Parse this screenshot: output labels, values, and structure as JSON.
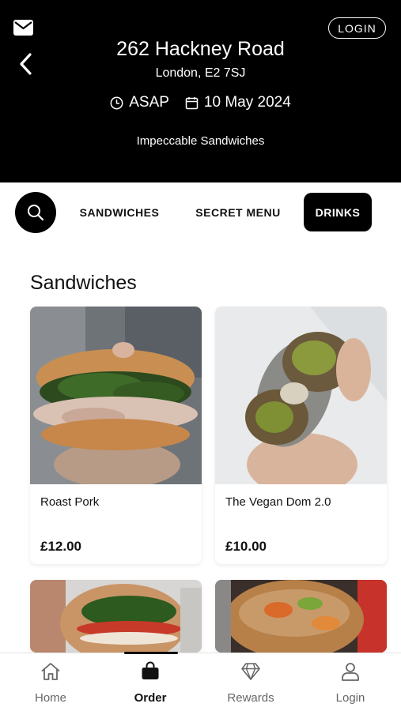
{
  "header": {
    "login_label": "LOGIN",
    "address_title": "262 Hackney Road",
    "address_sub": "London, E2 7SJ",
    "time_label": "ASAP",
    "date_label": "10 May 2024",
    "tagline": "Impeccable Sandwiches"
  },
  "categories": {
    "items": [
      {
        "label": "SANDWICHES",
        "active": false
      },
      {
        "label": "SECRET MENU",
        "active": false
      },
      {
        "label": "DRINKS",
        "active": true
      }
    ]
  },
  "section": {
    "title": "Sandwiches"
  },
  "products": [
    {
      "name": "Roast Pork",
      "price": "£12.00"
    },
    {
      "name": "The Vegan Dom 2.0",
      "price": "£10.00"
    },
    {
      "name": "",
      "price": ""
    },
    {
      "name": "",
      "price": ""
    }
  ],
  "tabbar": {
    "items": [
      {
        "label": "Home",
        "icon": "home-icon",
        "active": false
      },
      {
        "label": "Order",
        "icon": "bag-icon",
        "active": true
      },
      {
        "label": "Rewards",
        "icon": "diamond-icon",
        "active": false
      },
      {
        "label": "Login",
        "icon": "user-icon",
        "active": false
      }
    ]
  },
  "colors": {
    "header_bg": "#000000",
    "accent": "#000000",
    "inactive_text": "#666666"
  }
}
